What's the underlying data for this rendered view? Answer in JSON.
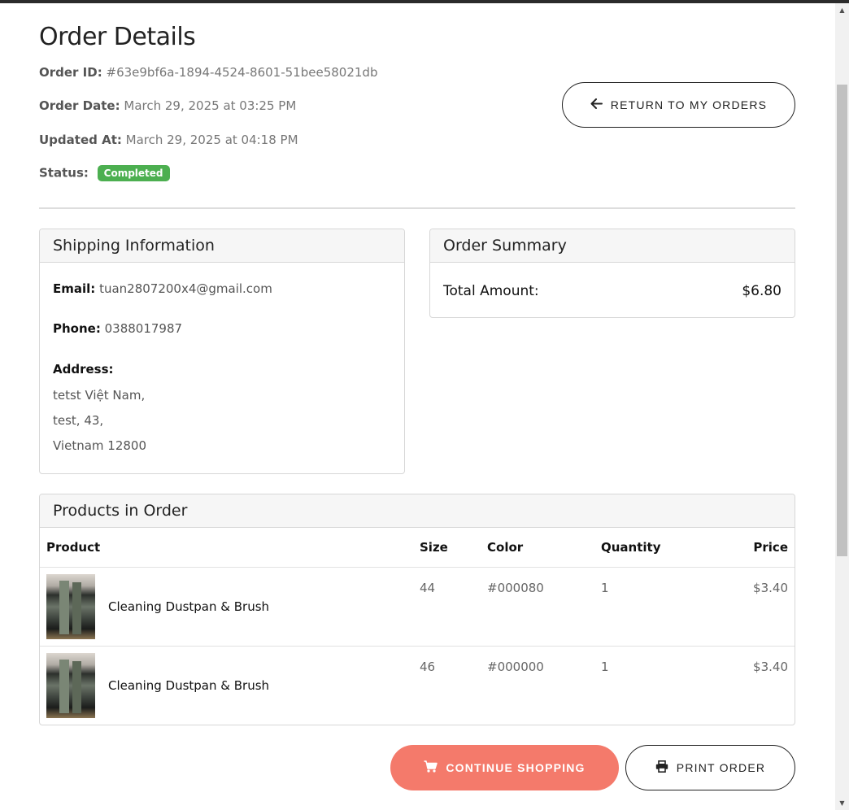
{
  "page": {
    "title": "Order Details"
  },
  "order": {
    "id_label": "Order ID:",
    "id_value": "#63e9bf6a-1894-4524-8601-51bee58021db",
    "date_label": "Order Date:",
    "date_value": "March 29, 2025 at 03:25 PM",
    "updated_label": "Updated At:",
    "updated_value": "March 29, 2025 at 04:18 PM",
    "status_label": "Status:",
    "status_value": "Completed",
    "status_color": "#4caf50"
  },
  "actions": {
    "return_label": "RETURN TO MY ORDERS",
    "return_icon": "arrow-left-icon",
    "continue_label": "CONTINUE SHOPPING",
    "continue_icon": "cart-icon",
    "print_label": "PRINT ORDER",
    "print_icon": "printer-icon",
    "accent_color": "#f47a6b"
  },
  "shipping": {
    "title": "Shipping Information",
    "email_label": "Email:",
    "email_value": "tuan2807200x4@gmail.com",
    "phone_label": "Phone:",
    "phone_value": "0388017987",
    "address_label": "Address:",
    "address_lines": [
      "tetst Việt Nam,",
      "test, 43,",
      "Vietnam 12800"
    ]
  },
  "summary": {
    "title": "Order Summary",
    "total_label": "Total Amount:",
    "total_value": "$6.80"
  },
  "products": {
    "title": "Products in Order",
    "columns": [
      "Product",
      "Size",
      "Color",
      "Quantity",
      "Price"
    ],
    "rows": [
      {
        "name": "Cleaning Dustpan & Brush",
        "size": "44",
        "color": "#000080",
        "quantity": "1",
        "price": "$3.40"
      },
      {
        "name": "Cleaning Dustpan & Brush",
        "size": "46",
        "color": "#000000",
        "quantity": "1",
        "price": "$3.40"
      }
    ]
  }
}
